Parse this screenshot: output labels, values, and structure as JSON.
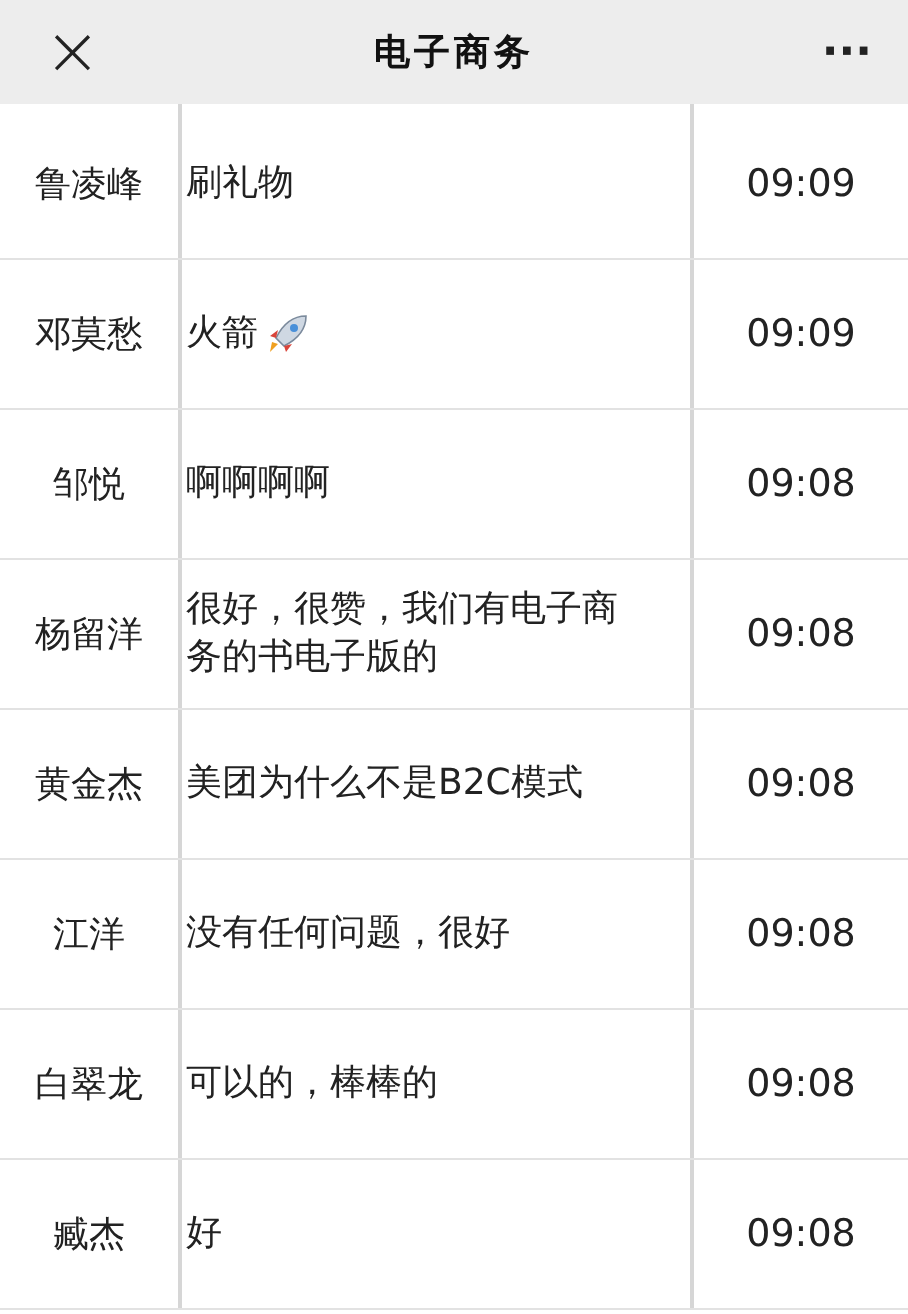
{
  "header": {
    "title": "电子商务",
    "close": "×",
    "more": "···"
  },
  "rows": [
    {
      "kind": "text",
      "name": "鲁凌峰",
      "message": "刷礼物",
      "time": "09:09"
    },
    {
      "kind": "rocket",
      "name": "邓莫愁",
      "message": "火箭",
      "time": "09:09"
    },
    {
      "kind": "text",
      "name": "邹悦",
      "message": "啊啊啊啊",
      "time": "09:08"
    },
    {
      "kind": "text",
      "name": "杨留洋",
      "message": "很好，很赞，我们有电子商务的书电子版的",
      "time": "09:08"
    },
    {
      "kind": "text",
      "name": "黄金杰",
      "message": "美团为什么不是B2C模式",
      "time": "09:08"
    },
    {
      "kind": "text",
      "name": "江洋",
      "message": "没有任何问题，很好",
      "time": "09:08"
    },
    {
      "kind": "text",
      "name": "白翠龙",
      "message": "可以的，棒棒的",
      "time": "09:08"
    },
    {
      "kind": "text",
      "name": "臧杰",
      "message": "好",
      "time": "09:08"
    }
  ]
}
